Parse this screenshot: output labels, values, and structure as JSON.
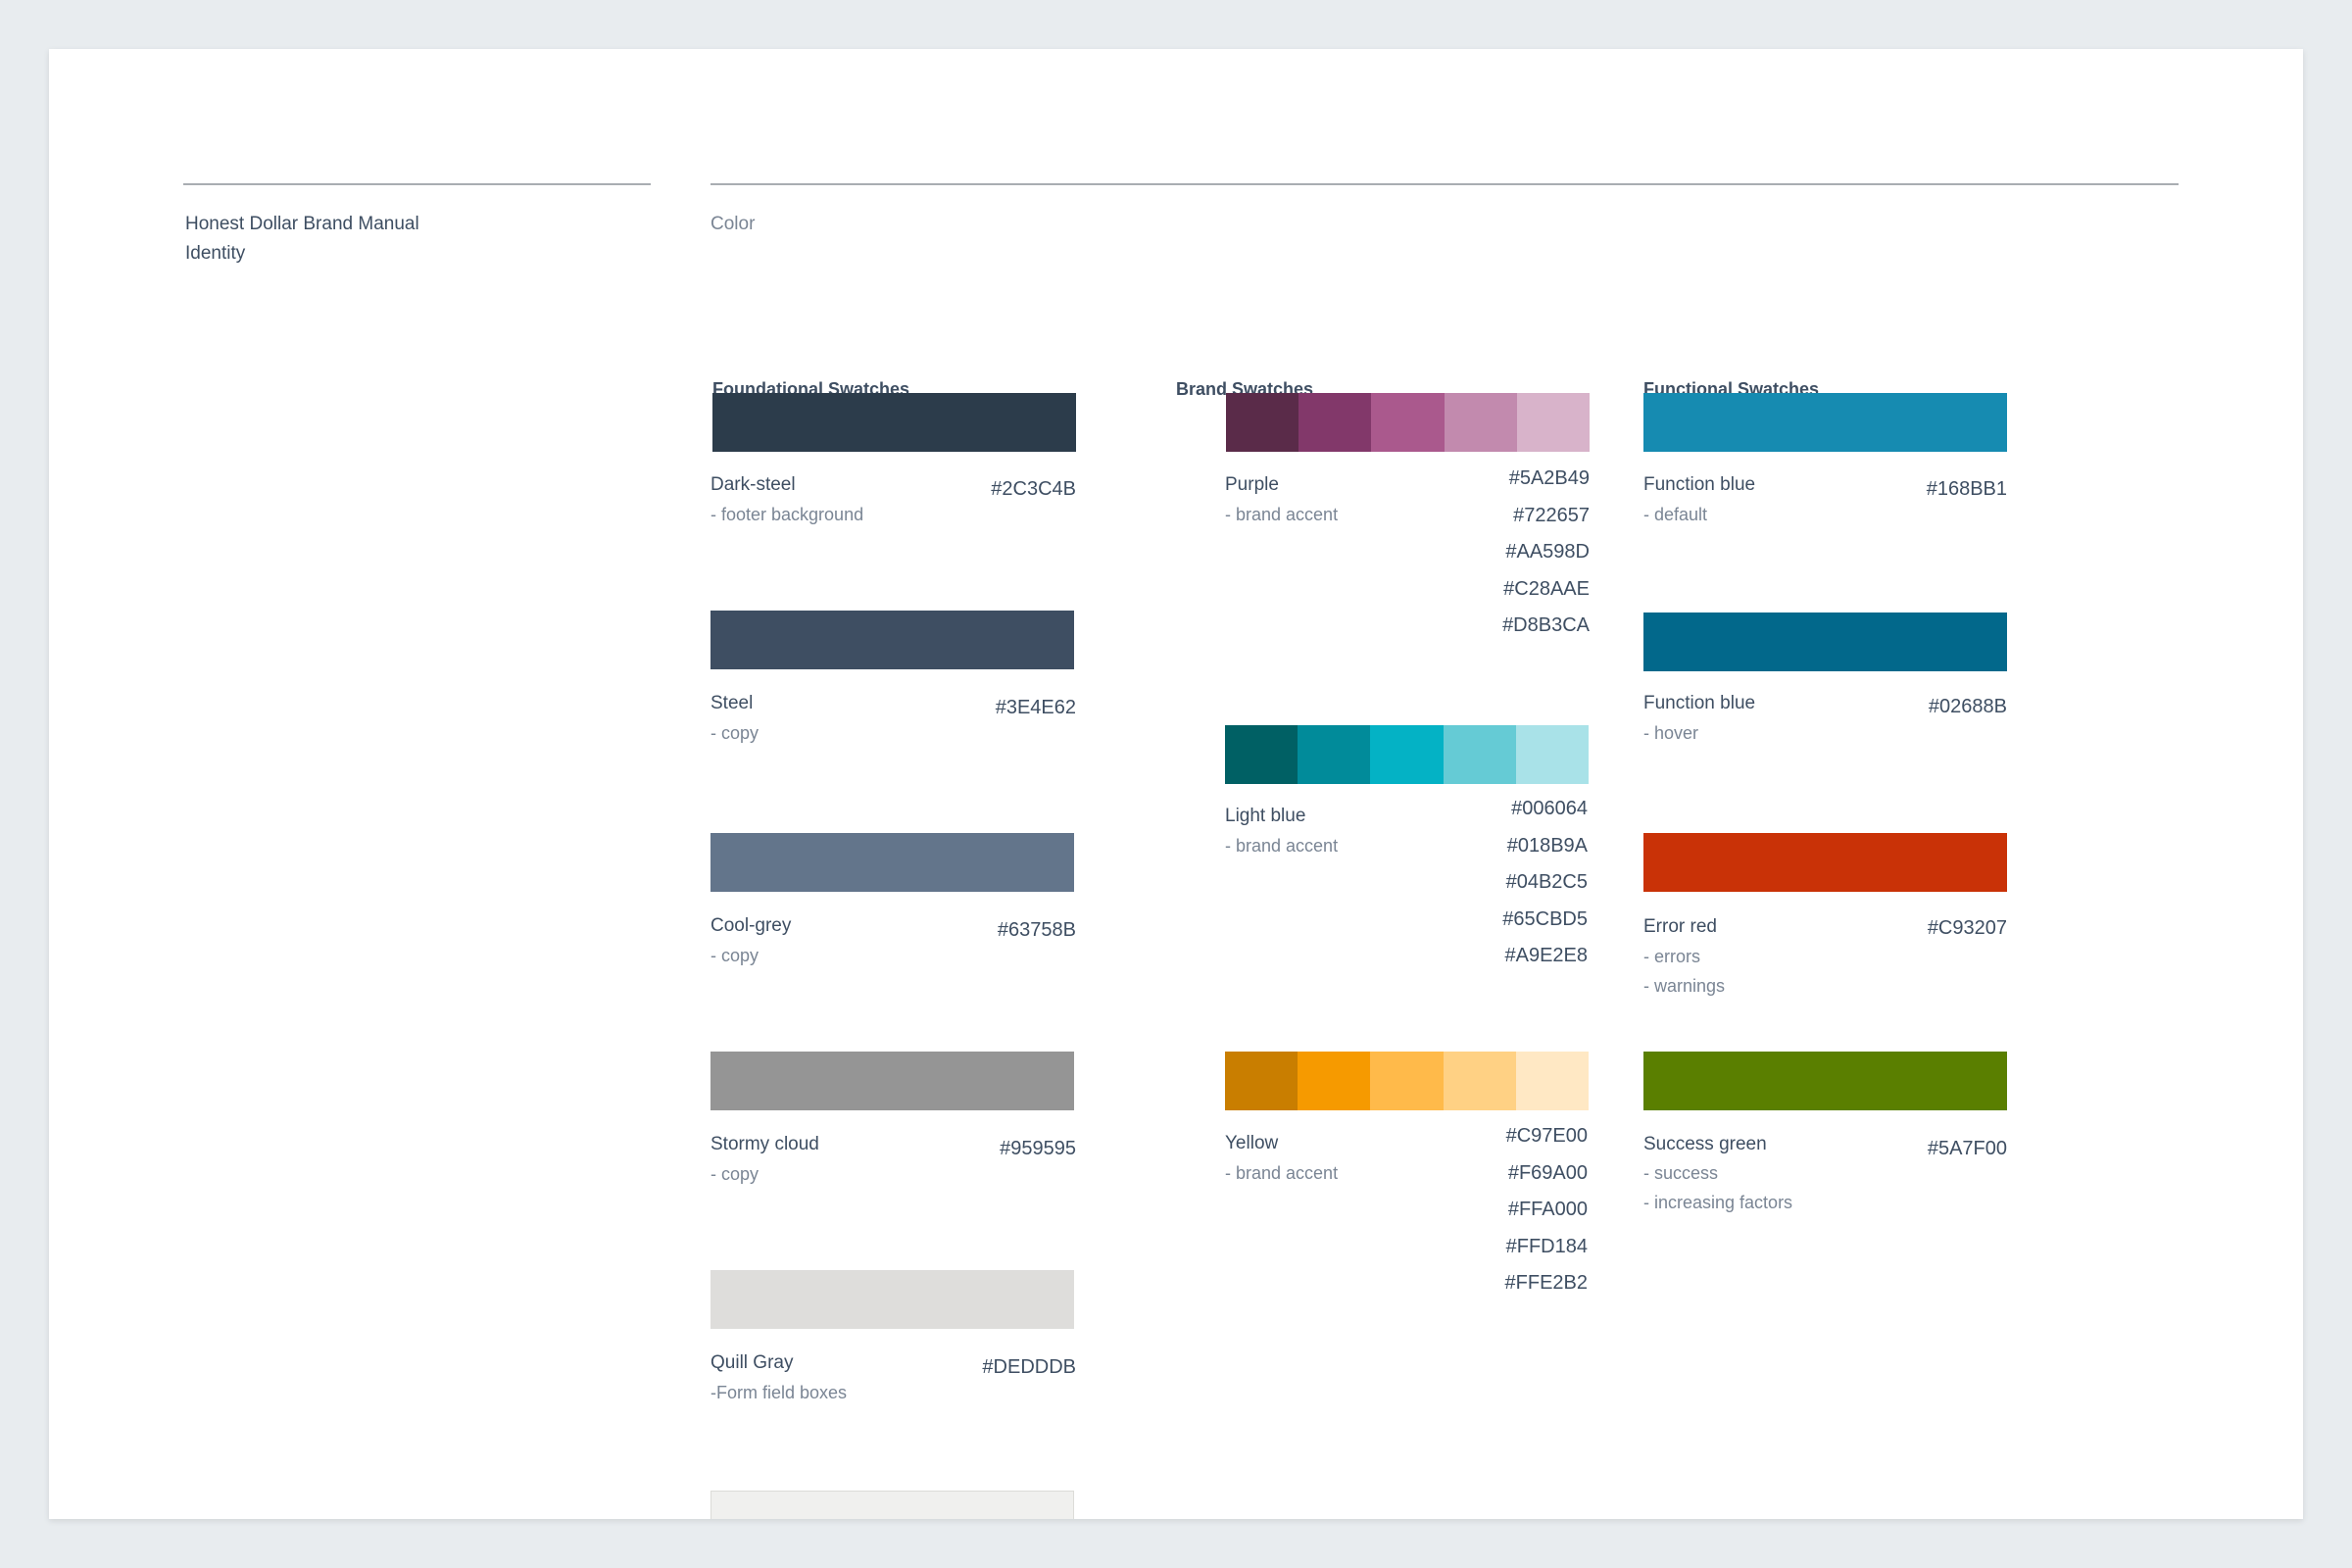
{
  "header": {
    "manual_title": "Honest Dollar Brand Manual",
    "section": "Identity",
    "topic": "Color"
  },
  "columns": {
    "foundational": "Foundational Swatches",
    "brand": "Brand Swatches",
    "functional": "Functional Swatches"
  },
  "foundational": [
    {
      "name": "Dark-steel",
      "desc": "- footer background",
      "hex": "#2C3C4B",
      "color": "#2C3C4B"
    },
    {
      "name": "Steel",
      "desc": "- copy",
      "hex": "#3E4E62",
      "color": "#3E4E62"
    },
    {
      "name": "Cool-grey",
      "desc": "- copy",
      "hex": "#63758B",
      "color": "#63758B"
    },
    {
      "name": "Stormy cloud",
      "desc": "- copy",
      "hex": "#959595",
      "color": "#959595"
    },
    {
      "name": "Quill Gray",
      "desc": "-Form field boxes",
      "hex": "#DEDDDB",
      "color": "#DEDDDB"
    },
    {
      "color": "#F0F0EE"
    }
  ],
  "brand": [
    {
      "name": "Purple",
      "desc": "- brand accent",
      "hexes": [
        "#5A2B49",
        "#722657",
        "#AA598D",
        "#C28AAE",
        "#D8B3CA"
      ],
      "colors": [
        "#5A2B49",
        "#82386A",
        "#AA598D",
        "#C28AAE",
        "#D8B3CA"
      ]
    },
    {
      "name": "Light blue",
      "desc": "- brand accent",
      "hexes": [
        "#006064",
        "#018B9A",
        "#04B2C5",
        "#65CBD5",
        "#A9E2E8"
      ],
      "colors": [
        "#006064",
        "#018B9A",
        "#04B2C5",
        "#65CBD5",
        "#A9E2E8"
      ]
    },
    {
      "name": "Yellow",
      "desc": "- brand accent",
      "hexes": [
        "#C97E00",
        "#F69A00",
        "#FFA000",
        "#FFD184",
        "#FFE2B2"
      ],
      "colors": [
        "#C97E00",
        "#F69A00",
        "#FFBA4A",
        "#FFD184",
        "#FFE8C4"
      ]
    }
  ],
  "functional": [
    {
      "name": "Function blue",
      "desc": [
        "- default"
      ],
      "hex": "#168BB1",
      "color": "#168BB1"
    },
    {
      "name": "Function blue",
      "desc": [
        "- hover"
      ],
      "hex": "#02688B",
      "color": "#02688B"
    },
    {
      "name": "Error red",
      "desc": [
        "- errors",
        "- warnings"
      ],
      "hex": "#C93207",
      "color": "#C93207"
    },
    {
      "name": "Success green",
      "desc": [
        "- success",
        "- increasing factors"
      ],
      "hex": "#5A7F00",
      "color": "#5A7F00"
    }
  ]
}
